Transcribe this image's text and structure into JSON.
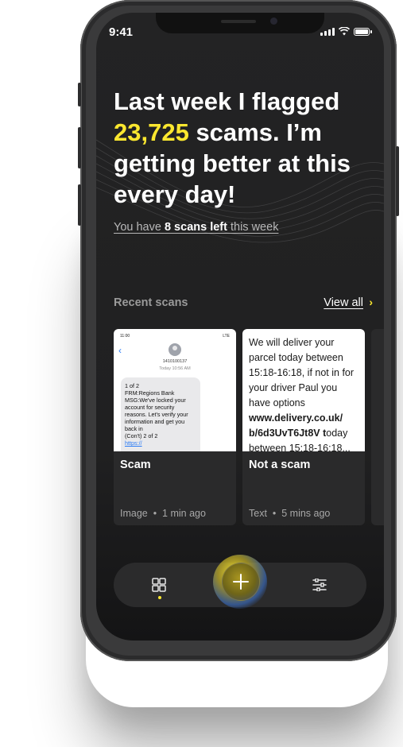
{
  "status_bar": {
    "time": "9:41"
  },
  "hero": {
    "line_before": "Last week I flagged",
    "count": "23,725",
    "line_after": " scams. I’m getting better at this every day!",
    "scans_prefix": "You have ",
    "scans_bold": "8 scans left",
    "scans_suffix": " this week"
  },
  "recent": {
    "title": "Recent scans",
    "view_all": "View all",
    "chevron": "›",
    "cards": [
      {
        "verdict": "Scam",
        "type": "Image",
        "separator": "•",
        "time": "1 min ago",
        "preview": {
          "status_time": "11:00",
          "status_right": "LTE",
          "number": "1410100137",
          "date": "Today 10:56 AM",
          "message": "1 of 2\nFRM:Regions Bank\nMSG:We've locked  your account for security reasons. Let's verify your information and get you back in\n(Con't) 2 of 2",
          "link": "https://"
        }
      },
      {
        "verdict": "Not a scam",
        "type": "Text",
        "separator": "•",
        "time": "5 mins ago",
        "preview": {
          "text_before": "We will deliver your parcel today between 15:18-16:18, if not in for your driver Paul you have options ",
          "link_bold": "www.delivery.co.uk/ b/6d3UvT6Jt8V t",
          "text_after": "oday between 15:18-16:18..."
        }
      }
    ]
  },
  "tabbar": {
    "items": [
      "grid-icon",
      "plus-icon",
      "filters-icon"
    ],
    "accent": "#fbe72f"
  },
  "colors": {
    "accent": "#fbe72f",
    "background": "#222223",
    "card": "#2a2a2b"
  }
}
